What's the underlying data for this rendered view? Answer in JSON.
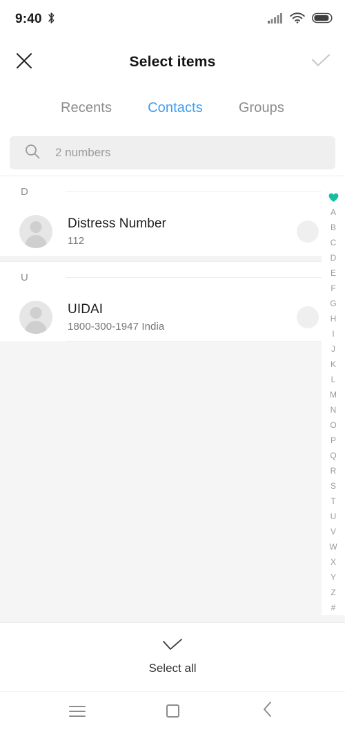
{
  "status_bar": {
    "time": "9:40",
    "bluetooth_icon": "bluetooth-icon",
    "signal_icon": "signal-bars-icon",
    "wifi_icon": "wifi-icon",
    "battery_icon": "battery-icon"
  },
  "header": {
    "title": "Select items",
    "close_icon": "close-icon",
    "confirm_icon": "check-icon",
    "confirm_color": "#c9c9c9"
  },
  "tabs": [
    {
      "label": "Recents",
      "active": false
    },
    {
      "label": "Contacts",
      "active": true
    },
    {
      "label": "Groups",
      "active": false
    }
  ],
  "tab_active_color": "#3d9ef0",
  "search": {
    "icon": "search-icon",
    "placeholder": "2 numbers",
    "value": ""
  },
  "sections": [
    {
      "letter": "D",
      "contacts": [
        {
          "name": "Distress Number",
          "subtitle": "112",
          "avatar": "person-avatar",
          "selected": false
        }
      ]
    },
    {
      "letter": "U",
      "contacts": [
        {
          "name": "UIDAI",
          "subtitle": "1800-300-1947  India",
          "avatar": "person-avatar",
          "selected": false
        }
      ]
    }
  ],
  "alpha_index": {
    "favorites_icon": "heart-icon",
    "favorites_color": "#16bda0",
    "letters": [
      "A",
      "B",
      "C",
      "D",
      "E",
      "F",
      "G",
      "H",
      "I",
      "J",
      "K",
      "L",
      "M",
      "N",
      "O",
      "P",
      "Q",
      "R",
      "S",
      "T",
      "U",
      "V",
      "W",
      "X",
      "Y",
      "Z",
      "#"
    ]
  },
  "bottom_bar": {
    "icon": "check-icon",
    "label": "Select all"
  },
  "nav_bar": {
    "recents_icon": "menu-icon",
    "home_icon": "square-home-icon",
    "back_icon": "back-chevron-icon"
  }
}
